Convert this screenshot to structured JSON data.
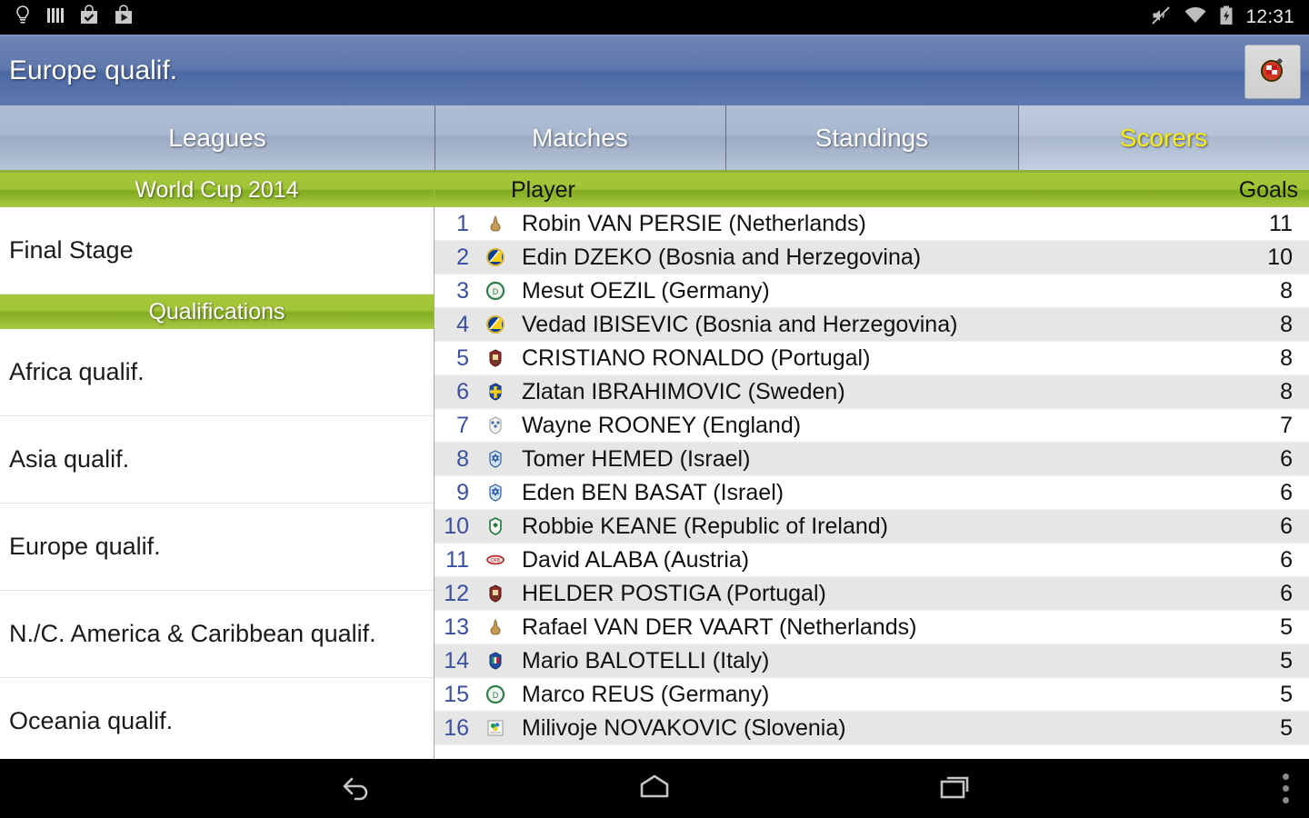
{
  "status_bar": {
    "time": "12:31",
    "left_icons": [
      "lightbulb-icon",
      "bars-icon",
      "checkbox-bag-icon",
      "play-bag-icon"
    ],
    "right_icons": [
      "mute-icon",
      "wifi-icon",
      "battery-charging-icon"
    ]
  },
  "title_bar": {
    "title": "Europe qualif.",
    "action_icon": "app-crest-icon"
  },
  "tabs": [
    {
      "label": "Leagues",
      "selected": false
    },
    {
      "label": "Matches",
      "selected": false
    },
    {
      "label": "Standings",
      "selected": false
    },
    {
      "label": "Scorers",
      "selected": true
    }
  ],
  "left_panel": {
    "sections": [
      {
        "header": "World Cup 2014",
        "items": [
          {
            "label": "Final Stage"
          }
        ]
      },
      {
        "header": "Qualifications",
        "items": [
          {
            "label": "Africa qualif."
          },
          {
            "label": "Asia qualif."
          },
          {
            "label": "Europe qualif."
          },
          {
            "label": "N./C. America & Caribbean qualif."
          },
          {
            "label": "Oceania qualif."
          }
        ]
      }
    ]
  },
  "scorers_table": {
    "columns": {
      "player": "Player",
      "goals": "Goals"
    },
    "rows": [
      {
        "rank": "1",
        "name": "Robin VAN PERSIE (Netherlands)",
        "goals": "11",
        "flag": "netherlands-flag-icon"
      },
      {
        "rank": "2",
        "name": "Edin DZEKO (Bosnia and Herzegovina)",
        "goals": "10",
        "flag": "bosnia-and-herzegovina-flag-icon"
      },
      {
        "rank": "3",
        "name": "Mesut OEZIL (Germany)",
        "goals": "8",
        "flag": "germany-flag-icon"
      },
      {
        "rank": "4",
        "name": "Vedad IBISEVIC (Bosnia and Herzegovina)",
        "goals": "8",
        "flag": "bosnia-and-herzegovina-flag-icon"
      },
      {
        "rank": "5",
        "name": "CRISTIANO RONALDO (Portugal)",
        "goals": "8",
        "flag": "portugal-flag-icon"
      },
      {
        "rank": "6",
        "name": "Zlatan IBRAHIMOVIC (Sweden)",
        "goals": "8",
        "flag": "sweden-flag-icon"
      },
      {
        "rank": "7",
        "name": "Wayne ROONEY (England)",
        "goals": "7",
        "flag": "england-flag-icon"
      },
      {
        "rank": "8",
        "name": "Tomer HEMED (Israel)",
        "goals": "6",
        "flag": "israel-flag-icon"
      },
      {
        "rank": "9",
        "name": "Eden BEN BASAT (Israel)",
        "goals": "6",
        "flag": "israel-flag-icon"
      },
      {
        "rank": "10",
        "name": "Robbie KEANE (Republic of Ireland)",
        "goals": "6",
        "flag": "republic-of-ireland-flag-icon"
      },
      {
        "rank": "11",
        "name": "David ALABA (Austria)",
        "goals": "6",
        "flag": "austria-flag-icon"
      },
      {
        "rank": "12",
        "name": "HELDER POSTIGA (Portugal)",
        "goals": "6",
        "flag": "portugal-flag-icon"
      },
      {
        "rank": "13",
        "name": "Rafael VAN DER VAART (Netherlands)",
        "goals": "5",
        "flag": "netherlands-flag-icon"
      },
      {
        "rank": "14",
        "name": "Mario BALOTELLI (Italy)",
        "goals": "5",
        "flag": "italy-flag-icon"
      },
      {
        "rank": "15",
        "name": "Marco REUS (Germany)",
        "goals": "5",
        "flag": "germany-flag-icon"
      },
      {
        "rank": "16",
        "name": "Milivoje NOVAKOVIC (Slovenia)",
        "goals": "5",
        "flag": "slovenia-flag-icon"
      }
    ]
  },
  "nav_bar": {
    "buttons": [
      "back-icon",
      "home-icon",
      "recents-icon"
    ],
    "overflow": "overflow-menu-icon"
  },
  "colors": {
    "title_blue": "#5f78ad",
    "tab_blue": "#a8b8d0",
    "header_green": "#a0c337",
    "selected_tab_text": "#f5ec1a",
    "rank_blue": "#3b4fa0",
    "row_alt": "#e6e6e6"
  }
}
